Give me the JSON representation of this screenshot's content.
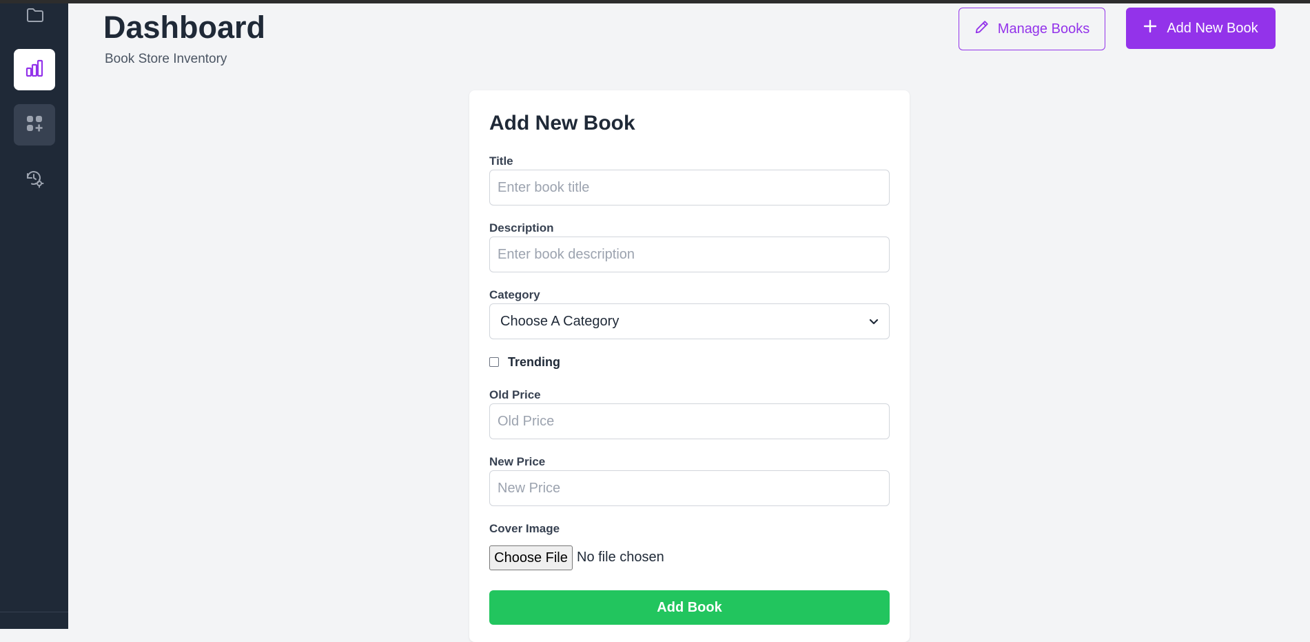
{
  "sidebar": {
    "items": [
      {
        "icon": "folder-icon"
      },
      {
        "icon": "bar-chart-icon",
        "active": true
      },
      {
        "icon": "add-category-icon"
      },
      {
        "icon": "history-settings-icon"
      }
    ]
  },
  "header": {
    "title": "Dashboard",
    "subtitle": "Book Store Inventory",
    "manage_label": "Manage Books",
    "add_label": "Add New Book"
  },
  "form": {
    "title": "Add New Book",
    "title_label": "Title",
    "title_placeholder": "Enter book title",
    "description_label": "Description",
    "description_placeholder": "Enter book description",
    "category_label": "Category",
    "category_value": "Choose A Category",
    "trending_label": "Trending",
    "trending_checked": false,
    "old_price_label": "Old Price",
    "old_price_placeholder": "Old Price",
    "new_price_label": "New Price",
    "new_price_placeholder": "New Price",
    "cover_label": "Cover Image",
    "file_button": "Choose File",
    "file_status": "No file chosen",
    "submit_label": "Add Book"
  },
  "colors": {
    "accent": "#9333ea",
    "sidebar_bg": "#1f2937",
    "submit": "#22c55e",
    "page_bg": "#f3f4f6"
  }
}
